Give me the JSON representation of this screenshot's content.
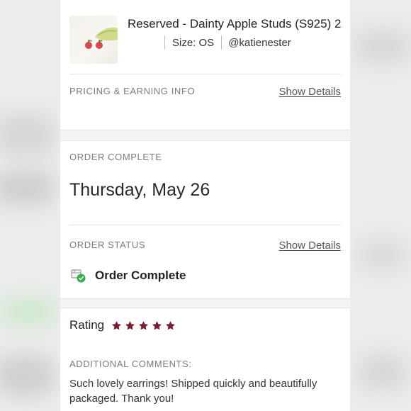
{
  "order": {
    "item_title": "Reserved - Dainty Apple Studs (S925) 2",
    "size": "Size: OS",
    "seller": "@katienester"
  },
  "pricing": {
    "label": "PRICING & EARNING INFO",
    "link": "Show Details"
  },
  "complete": {
    "label": "ORDER COMPLETE",
    "date": "Thursday, May 26"
  },
  "status": {
    "label": "ORDER STATUS",
    "link": "Show Details",
    "value": "Order Complete",
    "icon": "package-check-icon"
  },
  "rating": {
    "label": "Rating",
    "stars": 5,
    "max_stars": 5,
    "star_color": "#7a1d2e"
  },
  "comments": {
    "label": "ADDITIONAL COMMENTS:",
    "text": "Such lovely earrings! Shipped quickly and beautifully packaged. Thank you!"
  }
}
